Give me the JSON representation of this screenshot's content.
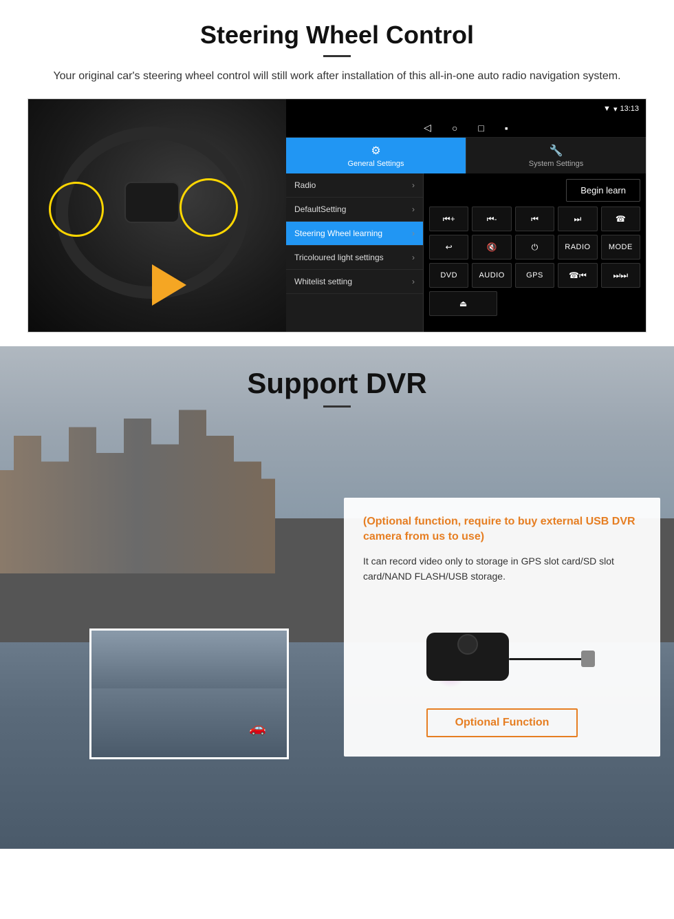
{
  "steering": {
    "section_title": "Steering Wheel Control",
    "subtitle": "Your original car's steering wheel control will still work after installation of this all-in-one auto radio navigation system.",
    "statusbar": {
      "time": "13:13",
      "signal": "▼"
    },
    "tabs": {
      "general": "General Settings",
      "system": "System Settings"
    },
    "menu_items": [
      {
        "label": "Radio",
        "active": false
      },
      {
        "label": "DefaultSetting",
        "active": false
      },
      {
        "label": "Steering Wheel learning",
        "active": true
      },
      {
        "label": "Tricoloured light settings",
        "active": false
      },
      {
        "label": "Whitelist setting",
        "active": false
      }
    ],
    "begin_learn": "Begin learn",
    "control_buttons": [
      [
        "⏮+",
        "⏮-",
        "⏮",
        "⏭",
        "☎"
      ],
      [
        "↩",
        "🔇",
        "⏻",
        "RADIO",
        "MODE"
      ],
      [
        "DVD",
        "AUDIO",
        "GPS",
        "☎⏮",
        "⏭⏭"
      ],
      [
        "⏏"
      ]
    ]
  },
  "dvr": {
    "section_title": "Support DVR",
    "optional_text": "(Optional function, require to buy external USB DVR camera from us to use)",
    "description": "It can record video only to storage in GPS slot card/SD slot card/NAND FLASH/USB storage.",
    "optional_button": "Optional Function"
  }
}
